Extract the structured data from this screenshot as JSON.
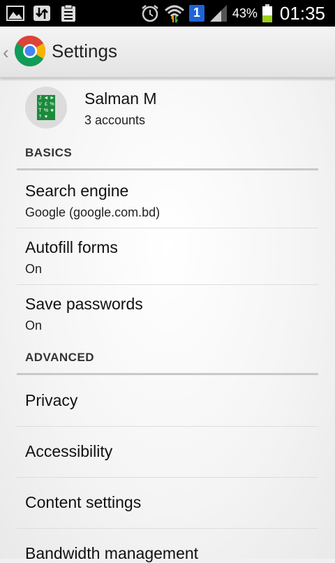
{
  "status_bar": {
    "battery_percent": "43%",
    "battery_level": 0.43,
    "notification_badge": "1",
    "clock": "01:35",
    "icons": [
      "gallery-icon",
      "sync-icon",
      "clipboard-icon",
      "alarm-icon",
      "wifi-icon",
      "sim-badge-icon",
      "signal-icon",
      "battery-icon"
    ]
  },
  "action_bar": {
    "title": "Settings",
    "back_glyph": "‹",
    "logo": "chrome-logo-icon"
  },
  "account": {
    "name": "Salman M",
    "subtitle": "3 accounts",
    "avatar_glyphs": [
      "J",
      "◄",
      "►",
      "V",
      "£",
      "%",
      "T",
      "%",
      "★",
      "?",
      "♥",
      ""
    ]
  },
  "sections": {
    "basics": {
      "header": "BASICS",
      "items": [
        {
          "title": "Search engine",
          "summary": "Google (google.com.bd)"
        },
        {
          "title": "Autofill forms",
          "summary": "On"
        },
        {
          "title": "Save passwords",
          "summary": "On"
        }
      ]
    },
    "advanced": {
      "header": "ADVANCED",
      "items": [
        {
          "title": "Privacy"
        },
        {
          "title": "Accessibility"
        },
        {
          "title": "Content settings"
        },
        {
          "title": "Bandwidth management"
        }
      ]
    }
  },
  "colors": {
    "status_bar_bg": "#000000",
    "action_bar_bg": "#ebebeb",
    "battery_fill": "#9bd01b",
    "avatar_green": "#1c8a3c",
    "sim_badge": "#1e64d8"
  }
}
